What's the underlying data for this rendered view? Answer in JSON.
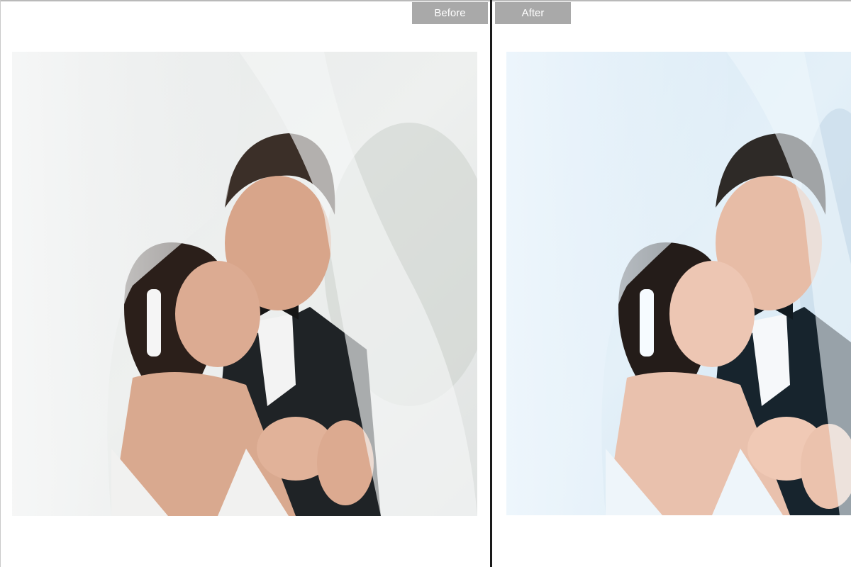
{
  "tabs": {
    "before_label": "Before",
    "after_label": "After"
  },
  "photos": {
    "before": {
      "variant": "original",
      "tone": {
        "background": "#e9ecec",
        "veil": "#f4f6f6",
        "skin": "#d9a98f",
        "suit": "#1f2326",
        "hair_man": "#3b2f28",
        "hair_woman": "#2b1f1a",
        "dress": "#f1f1f0",
        "mood": "warm"
      }
    },
    "after": {
      "variant": "edited",
      "tone": {
        "background": "#d9eaf6",
        "veil": "#edf6fc",
        "skin": "#e9c1ad",
        "suit": "#17242d",
        "hair_man": "#2e2a27",
        "hair_woman": "#241c19",
        "dress": "#eef5fa",
        "mood": "bright-cool"
      }
    }
  },
  "colors": {
    "tab_bg": "#a9a9a9",
    "tab_text": "#ffffff",
    "divider": "#1a1a1a"
  }
}
